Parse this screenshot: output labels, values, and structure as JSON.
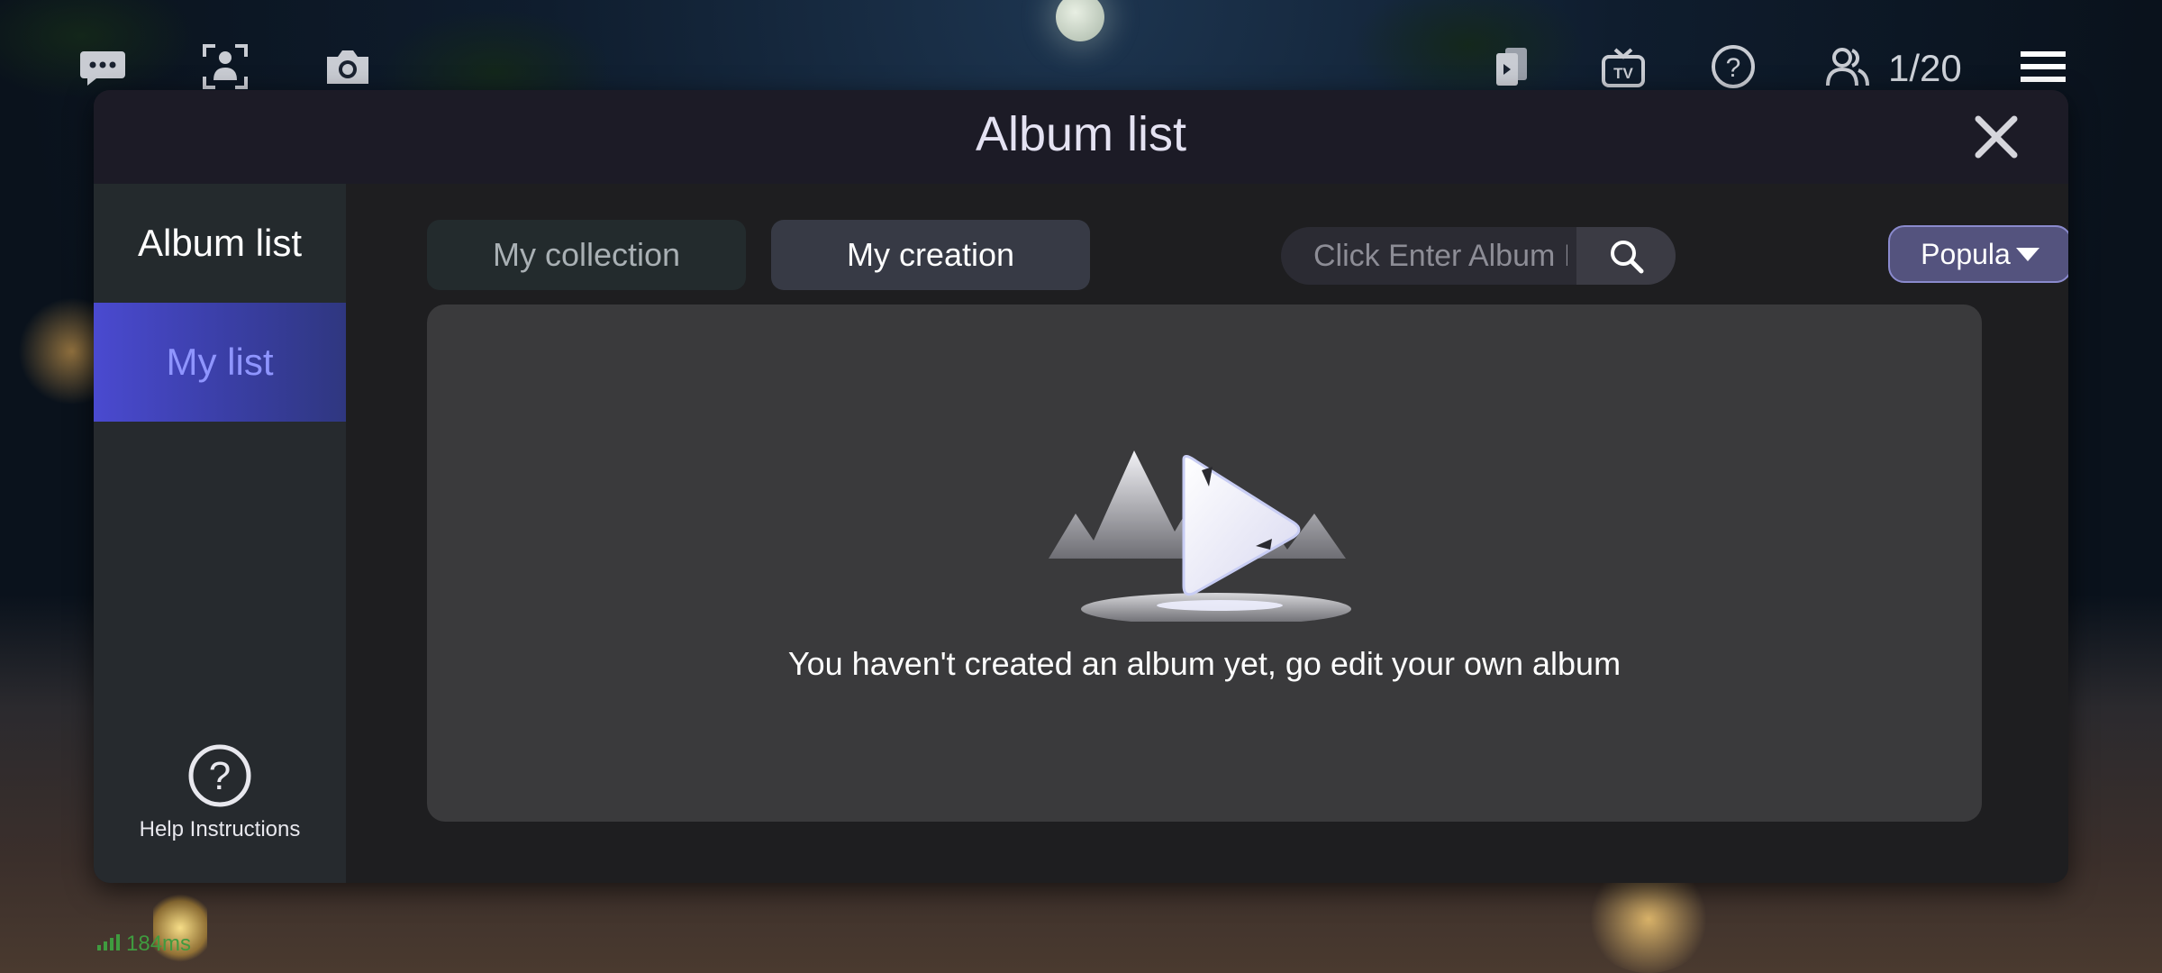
{
  "hud": {
    "player_count": "1/20",
    "icons": [
      "chat-icon",
      "avatar-scan-icon",
      "camera-icon",
      "cards-icon",
      "tv-icon",
      "help-icon",
      "players-icon",
      "menu-icon"
    ]
  },
  "modal": {
    "title": "Album list",
    "close_icon": "close-icon"
  },
  "sidebar": {
    "items": [
      {
        "label": "Album list",
        "selected": false
      },
      {
        "label": "My list",
        "selected": true
      }
    ],
    "help_label": "Help Instructions"
  },
  "tabs": [
    {
      "label": "My collection",
      "selected": false
    },
    {
      "label": "My creation",
      "selected": true
    }
  ],
  "search": {
    "placeholder": "Click Enter Album ID",
    "value": ""
  },
  "sort": {
    "selected": "Popula"
  },
  "empty_state": {
    "message": "You haven't created an album yet, go edit your own album"
  },
  "status": {
    "ping": "184ms"
  },
  "colors": {
    "accent": "#4a4ad0",
    "sidebar_selected_text": "#8f95ff",
    "panel": "#3a3a3c"
  }
}
